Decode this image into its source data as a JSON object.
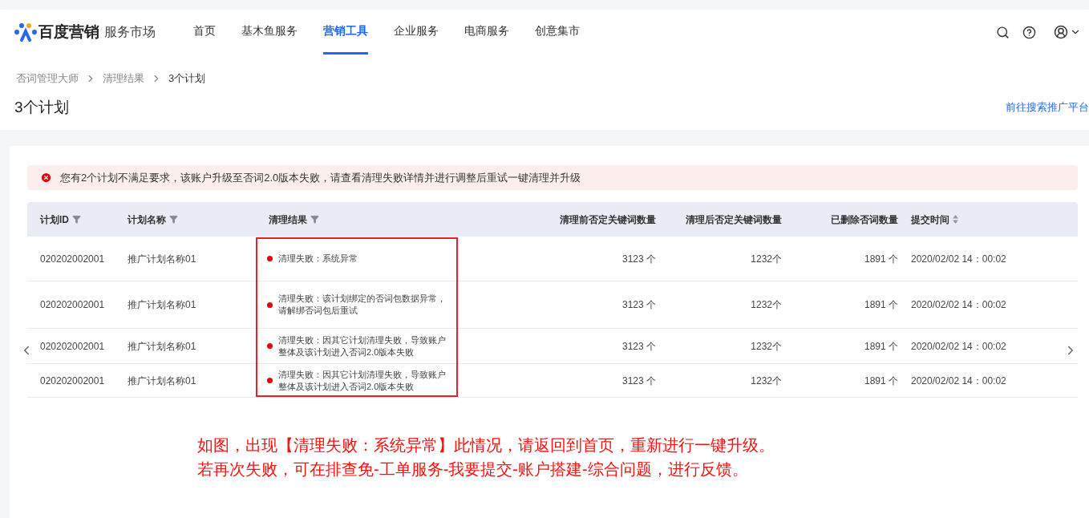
{
  "nav": {
    "brand": "百度营销",
    "subtitle": "服务市场",
    "items": [
      {
        "label": "首页",
        "selected": false
      },
      {
        "label": "基木鱼服务",
        "selected": false
      },
      {
        "label": "营销工具",
        "selected": true
      },
      {
        "label": "企业服务",
        "selected": false
      },
      {
        "label": "电商服务",
        "selected": false
      },
      {
        "label": "创意集市",
        "selected": false
      }
    ]
  },
  "breadcrumb": [
    "否词管理大师",
    "清理结果",
    "3个计划"
  ],
  "page_title": "3个计划",
  "header_link": "前往搜索推广平台",
  "alert": {
    "kind": "error",
    "message": "您有2个计划不满足要求，该账户升级至否词2.0版本失败，请查看清理失败详情并进行调整后重试一键清理并升级"
  },
  "table": {
    "columns": [
      {
        "label": "计划ID",
        "kind": "filter",
        "highlighted": false
      },
      {
        "label": "计划名称",
        "kind": "filter",
        "highlighted": false
      },
      {
        "label": "清理结果",
        "kind": "filter",
        "highlighted": true
      },
      {
        "label": "清理前否定关键词数量",
        "kind": "plain",
        "highlighted": false
      },
      {
        "label": "清理后否定关键词数量",
        "kind": "plain",
        "highlighted": false
      },
      {
        "label": "已删除否词数量",
        "kind": "plain",
        "highlighted": false
      },
      {
        "label": "提交时间",
        "kind": "sort",
        "highlighted": false
      }
    ],
    "rows": [
      {
        "cells": [
          "020202002001",
          "推广计划名称01",
          "清理失败：系统异常",
          "3123 个",
          "1232个",
          "1891 个",
          "2020/02/02 14：00:02"
        ],
        "kind": "error"
      },
      {
        "cells": [
          "020202002001",
          "推广计划名称01",
          "清理失败：该计划绑定的否词包数据异常，请解绑否词包后重试",
          "3123 个",
          "1232个",
          "1891 个",
          "2020/02/02 14：00:02"
        ],
        "kind": "error"
      },
      {
        "cells": [
          "020202002001",
          "推广计划名称01",
          "清理失败：因其它计划清理失败，导致账户整体及该计划进入否词2.0版本失败",
          "3123 个",
          "1232个",
          "1891 个",
          "2020/02/02 14：00:02"
        ],
        "kind": "error"
      },
      {
        "cells": [
          "020202002001",
          "推广计划名称01",
          "清理失败：因其它计划清理失败，导致账户整体及该计划进入否词2.0版本失败",
          "3123 个",
          "1232个",
          "1891 个",
          "2020/02/02 14：00:02"
        ],
        "kind": "error"
      }
    ]
  },
  "annotation": [
    "如图，出现【清理失败：系统异常】此情况，请返回到首页，重新进行一键升级。",
    "若再次失败，可在排查免-工单服务-我要提交-账户搭建-综合问题，进行反馈。"
  ]
}
